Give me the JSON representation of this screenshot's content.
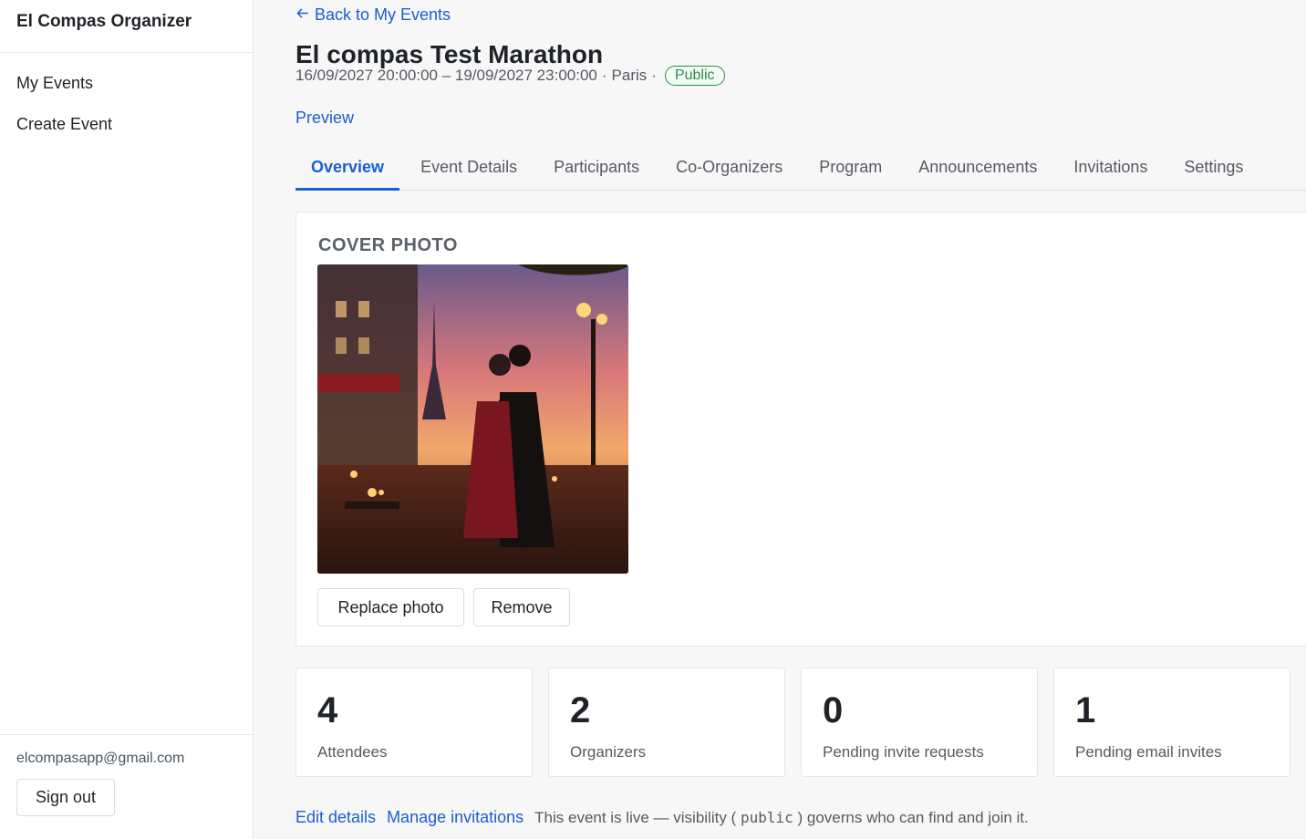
{
  "sidebar": {
    "brand": "El Compas Organizer",
    "nav": [
      {
        "label": "My Events"
      },
      {
        "label": "Create Event"
      }
    ],
    "user_email": "elcompasapp@gmail.com",
    "sign_out_label": "Sign out"
  },
  "header": {
    "back_label": "Back to My Events",
    "title": "El compas Test Marathon",
    "dates": "16/09/2027 20:00:00 – 19/09/2027 23:00:00",
    "sep1": "·",
    "city": "Paris",
    "sep2": "·",
    "visibility_badge": "Public",
    "preview_label": "Preview"
  },
  "tabs": [
    {
      "label": "Overview",
      "active": true
    },
    {
      "label": "Event Details"
    },
    {
      "label": "Participants"
    },
    {
      "label": "Co-Organizers"
    },
    {
      "label": "Program"
    },
    {
      "label": "Announcements"
    },
    {
      "label": "Invitations"
    },
    {
      "label": "Settings"
    }
  ],
  "cover": {
    "title": "COVER PHOTO",
    "replace_label": "Replace photo",
    "remove_label": "Remove"
  },
  "stats": [
    {
      "value": "4",
      "label": "Attendees"
    },
    {
      "value": "2",
      "label": "Organizers"
    },
    {
      "value": "0",
      "label": "Pending invite requests"
    },
    {
      "value": "1",
      "label": "Pending email invites"
    }
  ],
  "footer_row": {
    "edit_label": "Edit details",
    "manage_label": "Manage invitations",
    "note_prefix": "This event is live — visibility (",
    "note_code": "public",
    "note_suffix": ") governs who can find and join it."
  },
  "colors": {
    "accent": "#1a5fd0",
    "public_badge": "#2f8a4e"
  }
}
